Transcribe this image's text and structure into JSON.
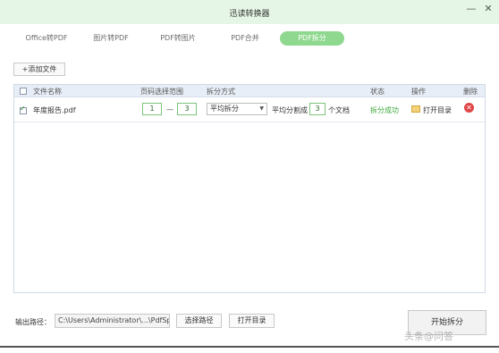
{
  "window": {
    "title": "迅读转换器",
    "minimize_glyph": "—",
    "close_glyph": "✕"
  },
  "tabs": [
    {
      "label": "Office转PDF",
      "active": false
    },
    {
      "label": "图片转PDF",
      "active": false
    },
    {
      "label": "PDF转图片",
      "active": false
    },
    {
      "label": "PDF合并",
      "active": false
    },
    {
      "label": "PDF拆分",
      "active": true
    }
  ],
  "toolbar": {
    "add_file_label": "+添加文件"
  },
  "table": {
    "columns": {
      "filename": "文件名称",
      "page_range": "页码选择范围",
      "split_mode": "拆分方式",
      "status": "状态",
      "action": "操作",
      "delete": "删除"
    },
    "rows": [
      {
        "checked": true,
        "filename": "年度报告.pdf",
        "range_from": "1",
        "range_dash": "—",
        "range_to": "3",
        "split_mode": "平均拆分",
        "avg_prefix": "平均分割成",
        "avg_count": "3",
        "avg_suffix": "个文档",
        "status": "拆分成功",
        "action_label": "打开目录",
        "delete_glyph": "✕"
      }
    ]
  },
  "output": {
    "label": "输出路径：",
    "path": "C:\\Users\\Administrator\\...\\PdfSplit",
    "choose_path_label": "选择路径",
    "open_dir_label": "打开目录"
  },
  "start_button_label": "开始拆分",
  "watermark_text": "头条@问答",
  "colors": {
    "accent": "#8fd88f",
    "success": "#3aa93a",
    "delete": "#e04646",
    "title_bar": "#e6f6e6"
  }
}
